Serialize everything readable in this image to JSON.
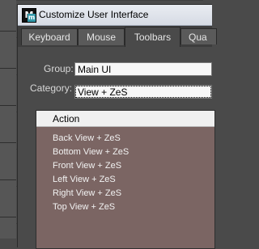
{
  "window": {
    "title": "Customize User Interface",
    "app_icon_letter": "M",
    "app_icon_sub": "m"
  },
  "tabs": [
    {
      "label": "Keyboard"
    },
    {
      "label": "Mouse"
    },
    {
      "label": "Toolbars"
    },
    {
      "label": "Qua"
    }
  ],
  "active_tab": "Toolbars",
  "group": {
    "label": "Group:",
    "value": "Main UI"
  },
  "category": {
    "label": "Category:",
    "value": "View + ZeS"
  },
  "action_list": {
    "header": "Action",
    "items": [
      "Back View + ZeS",
      "Bottom View + ZeS",
      "Front View + ZeS",
      "Left View + ZeS",
      "Right View + ZeS",
      "Top View + ZeS"
    ]
  }
}
